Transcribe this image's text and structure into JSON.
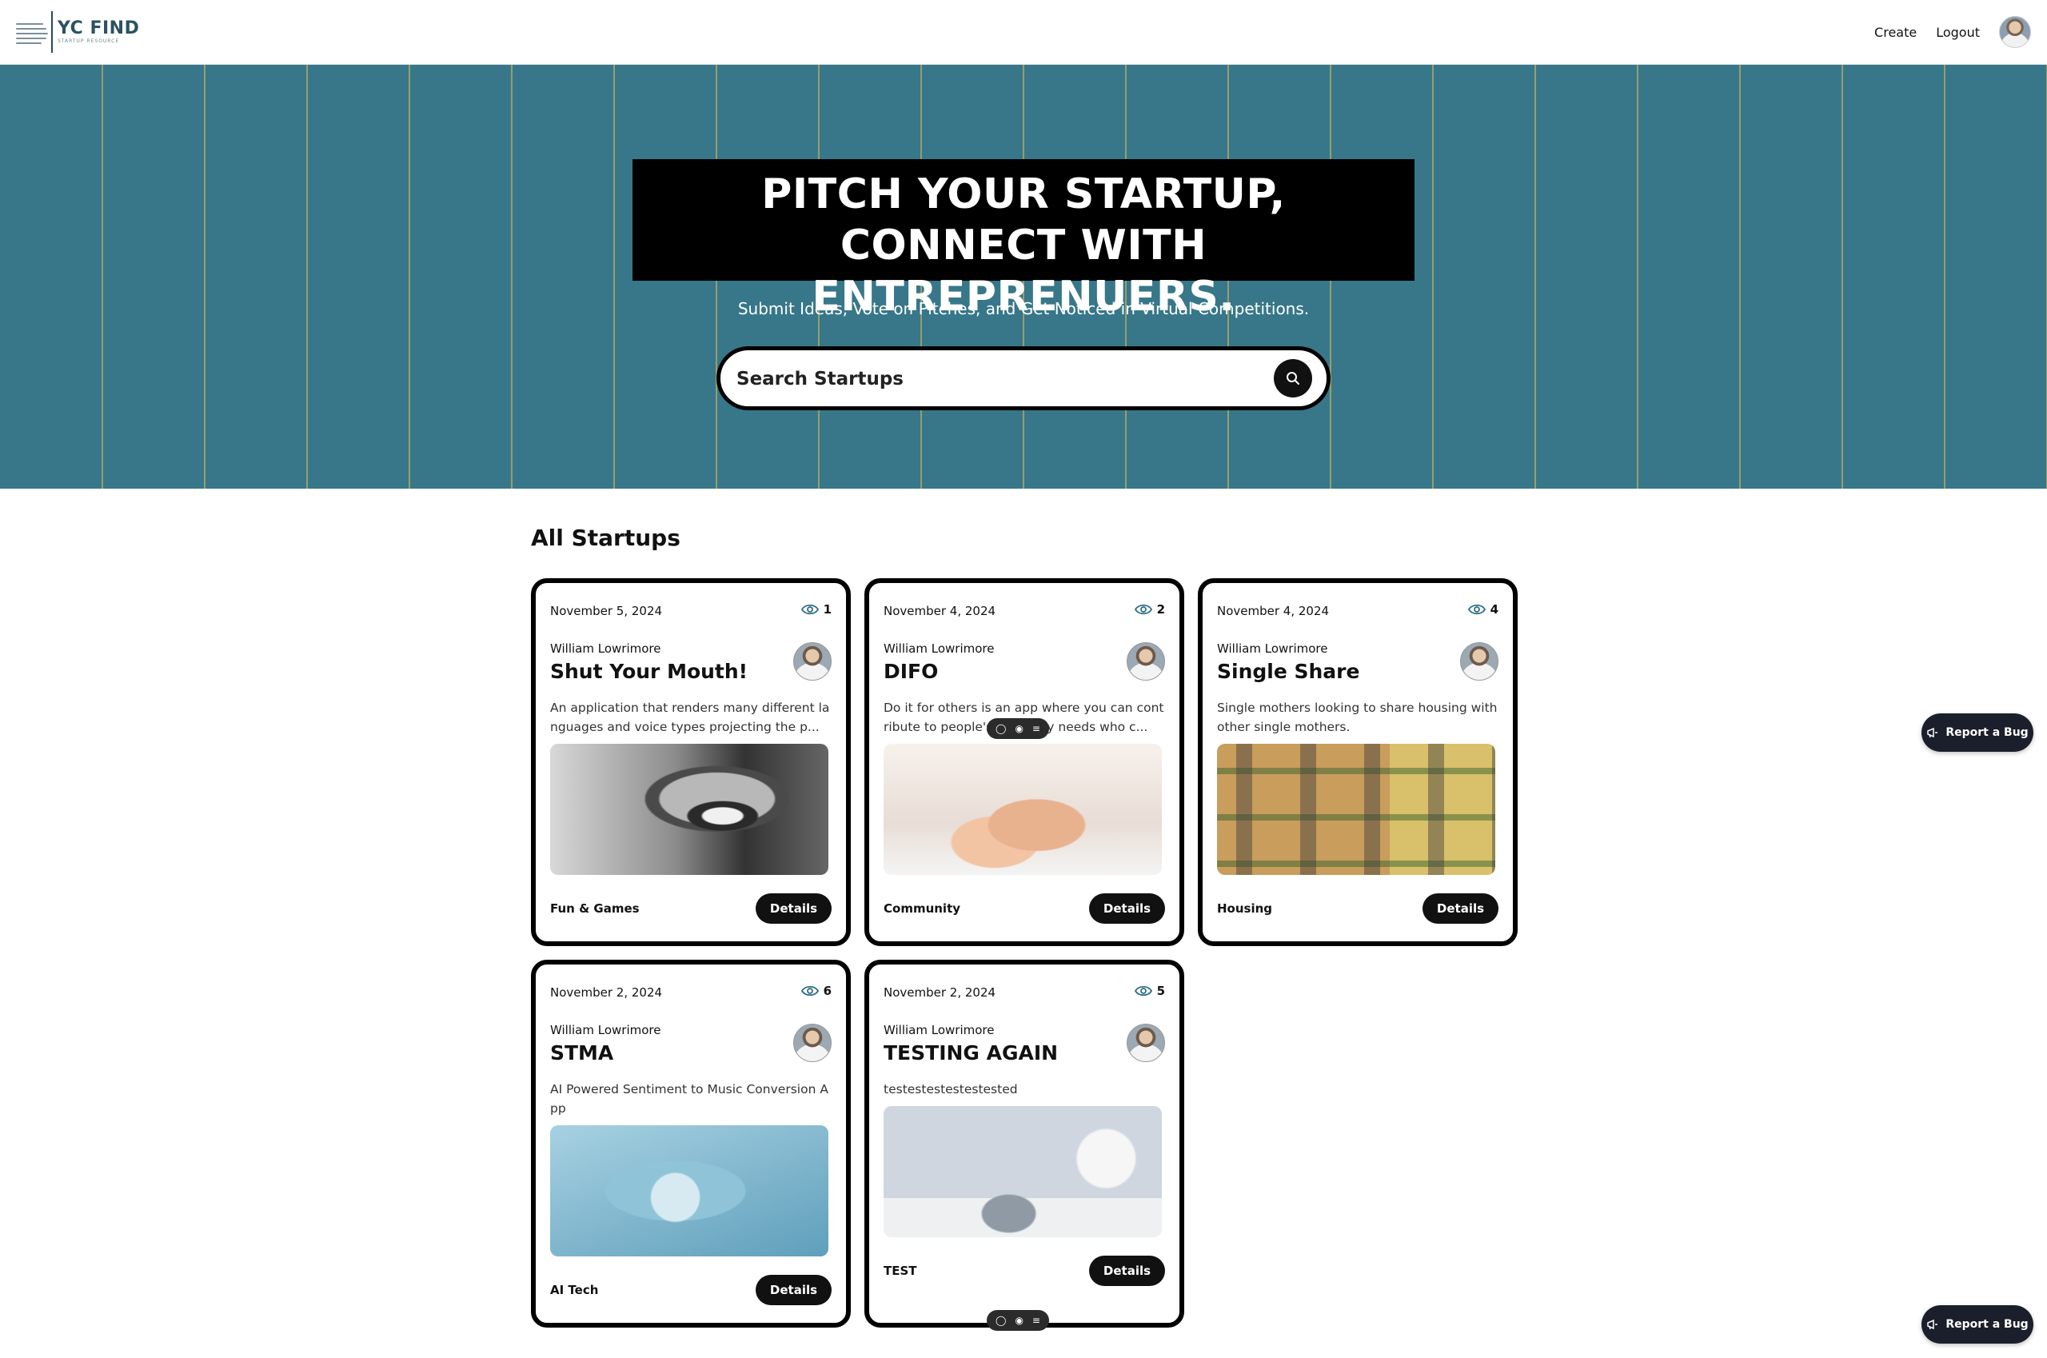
{
  "header": {
    "logo_title": "YC FIND",
    "logo_subtitle": "STARTUP RESOURCE",
    "nav": {
      "create": "Create",
      "logout": "Logout"
    }
  },
  "hero": {
    "title_line1": "PITCH YOUR STARTUP,",
    "title_line2": "CONNECT WITH ENTREPRENUERS.",
    "subtitle": "Submit Ideas, Vote on Pitches, and Get Noticed in Virtual Competitions.",
    "search_placeholder": "Search Startups",
    "colors": {
      "background": "#377789",
      "stripe": "#a8a468"
    }
  },
  "main": {
    "section_title": "All Startups",
    "details_label": "Details",
    "cards": [
      {
        "date": "November 5, 2024",
        "views": "1",
        "author": "William Lowrimore",
        "title": "Shut Your Mouth!",
        "description": "An application that renders many different languages and voice types projecting the p...",
        "category": "Fun & Games"
      },
      {
        "date": "November 4, 2024",
        "views": "2",
        "author": "William Lowrimore",
        "title": "DIFO",
        "description": "Do it for others is an app where you can contribute to people's everyday needs who c...",
        "category": "Community"
      },
      {
        "date": "November 4, 2024",
        "views": "4",
        "author": "William Lowrimore",
        "title": "Single Share",
        "description": "Single mothers looking to share housing with other single mothers.",
        "category": "Housing"
      },
      {
        "date": "November 2, 2024",
        "views": "6",
        "author": "William Lowrimore",
        "title": "STMA",
        "description": "AI Powered Sentiment to Music Conversion App",
        "category": "AI Tech"
      },
      {
        "date": "November 2, 2024",
        "views": "5",
        "author": "William Lowrimore",
        "title": "TESTING AGAIN",
        "description": "testestestestestested",
        "category": "TEST"
      }
    ]
  },
  "bug_button_label": "Report a Bug",
  "icons": [
    "eye-icon",
    "search-icon",
    "megaphone-icon",
    "comment-icon",
    "view-icon",
    "menu-icon"
  ]
}
